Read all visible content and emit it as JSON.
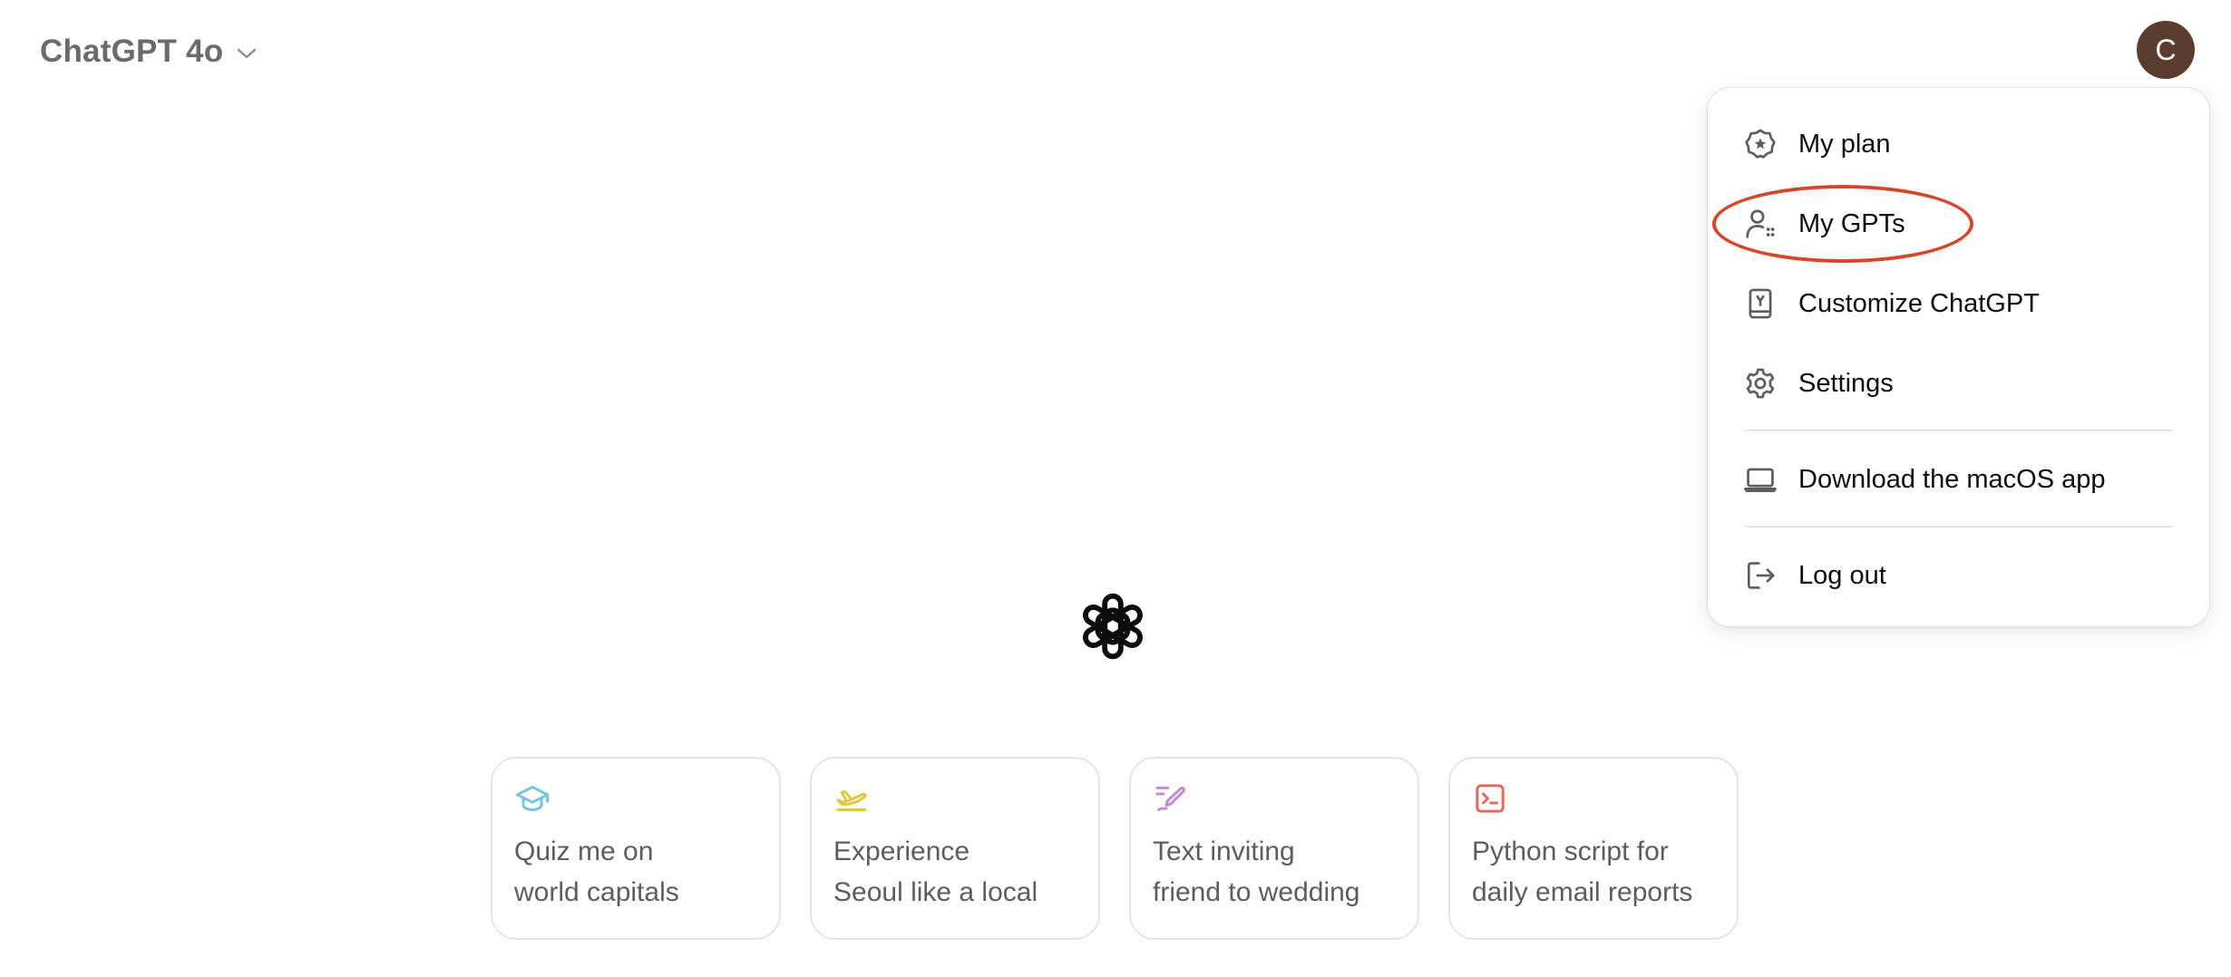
{
  "header": {
    "model_name": "ChatGPT 4o",
    "model_chevron_icon": "chevron-down-icon",
    "avatar_initial": "C"
  },
  "profile_menu": {
    "items": [
      {
        "label": "My plan",
        "icon": "plan-badge-icon"
      },
      {
        "label": "My GPTs",
        "icon": "gpts-icon",
        "highlighted": true
      },
      {
        "label": "Customize ChatGPT",
        "icon": "customize-icon"
      },
      {
        "label": "Settings",
        "icon": "gear-icon"
      },
      {
        "label": "Download the macOS app",
        "icon": "laptop-icon"
      },
      {
        "label": "Log out",
        "icon": "logout-icon"
      }
    ],
    "highlight_color": "#d6472a"
  },
  "center": {
    "logo_icon": "openai-logo-icon"
  },
  "suggestions": [
    {
      "line1": "Quiz me on",
      "line2": "world capitals",
      "icon": "graduation-cap-icon",
      "color": "#76c4e0"
    },
    {
      "line1": "Experience",
      "line2": "Seoul like a local",
      "icon": "airplane-icon",
      "color": "#e2c541"
    },
    {
      "line1": "Text inviting",
      "line2": "friend to wedding",
      "icon": "pen-icon",
      "color": "#c08bd4"
    },
    {
      "line1": "Python script for",
      "line2": "daily email reports",
      "icon": "terminal-icon",
      "color": "#e2695c"
    }
  ],
  "colors": {
    "avatar_bg": "#5b3d30",
    "menu_icon": "#5d5d5d",
    "text_muted": "#5d5d5d"
  }
}
